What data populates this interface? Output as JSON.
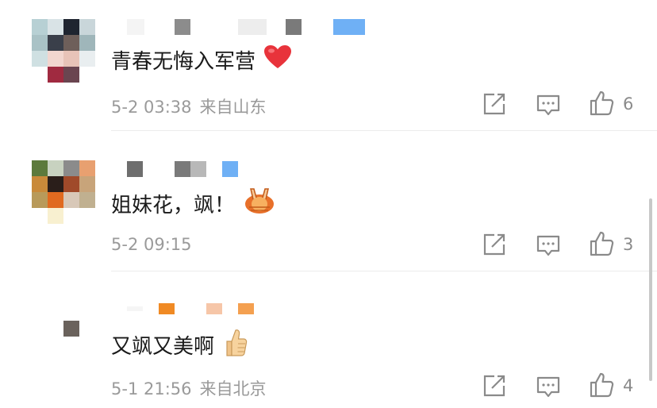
{
  "comments": [
    {
      "text": "青春无悔入军营",
      "emoji": "red-heart",
      "date": "5-2 03:38",
      "location": "来自山东",
      "likes": "6"
    },
    {
      "text": "姐妹花，飒！",
      "emoji": "fist-and-palm",
      "date": "5-2 09:15",
      "location": "",
      "likes": "3"
    },
    {
      "text": "又飒又美啊",
      "emoji": "thumbs-up",
      "date": "5-1 21:56",
      "location": "来自北京",
      "likes": "4"
    }
  ],
  "icons": {
    "share": "share-icon",
    "reply": "comment-icon",
    "like": "thumbs-up-icon"
  },
  "colors": {
    "text": "#1a1a1a",
    "meta": "#9a9a9a",
    "heart": "#e8333b",
    "name_blue": "#6fb0f5",
    "name_orange": "#f08a24"
  }
}
